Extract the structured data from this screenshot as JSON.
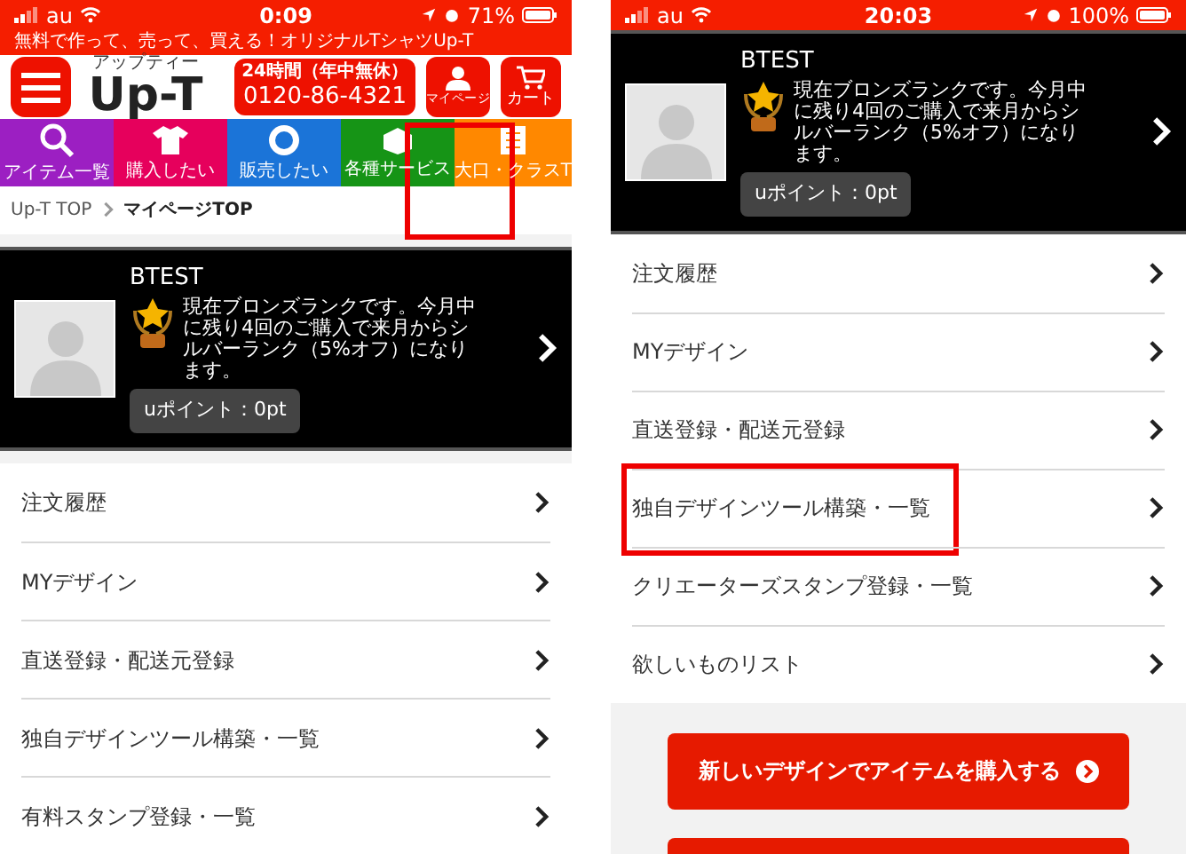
{
  "left": {
    "status_bar": {
      "carrier": "au",
      "time": "0:09",
      "battery": "71%"
    },
    "banner": "無料で作って、売って、買える！オリジナルTシャツUp-T",
    "header": {
      "logo": "Up-T",
      "logo_reading": "アップティー",
      "hours": "24時間（年中無休）",
      "phone": "0120-86-4321",
      "mypage": "マイページ",
      "cart": "カート"
    },
    "nav": [
      {
        "label": "アイテム一覧",
        "color": "#9c1fc2"
      },
      {
        "label": "購入したい",
        "color": "#e6005c"
      },
      {
        "label": "販売したい",
        "color": "#1b74d8"
      },
      {
        "label": "各種サービス",
        "color": "#169416"
      },
      {
        "label": "大口・クラスT",
        "color": "#ff8800"
      }
    ],
    "breadcrumb": [
      "Up-T TOP",
      "マイページTOP"
    ],
    "profile": {
      "name": "BTEST",
      "rank_text": "現在ブロンズランクです。今月中に残り4回のご購入で来月からシルバーランク（5%オフ）になります。",
      "points": "uポイント：0pt"
    },
    "menu": [
      {
        "label": "注文履歴",
        "highlighted": false
      },
      {
        "label": "MYデザイン",
        "highlighted": false
      },
      {
        "label": "直送登録・配送元登録",
        "highlighted": false
      },
      {
        "label": "独自デザインツール構築・一覧",
        "highlighted": false
      },
      {
        "label": "有料スタンプ登録・一覧",
        "highlighted": false
      }
    ]
  },
  "right": {
    "status_bar": {
      "carrier": "au",
      "time": "20:03",
      "battery": "100%"
    },
    "profile": {
      "name": "BTEST",
      "rank_text": "現在ブロンズランクです。今月中に残り4回のご購入で来月からシルバーランク（5%オフ）になります。",
      "points": "uポイント：0pt"
    },
    "menu": [
      {
        "label": "注文履歴",
        "highlighted": false
      },
      {
        "label": "MYデザイン",
        "highlighted": false
      },
      {
        "label": "直送登録・配送元登録",
        "highlighted": false
      },
      {
        "label": "独自デザインツール構築・一覧",
        "highlighted": true
      },
      {
        "label": "クリエーターズスタンプ登録・一覧",
        "highlighted": false
      },
      {
        "label": "欲しいものリスト",
        "highlighted": false
      }
    ],
    "buttons": [
      "新しいデザインでアイテムを購入する"
    ]
  }
}
